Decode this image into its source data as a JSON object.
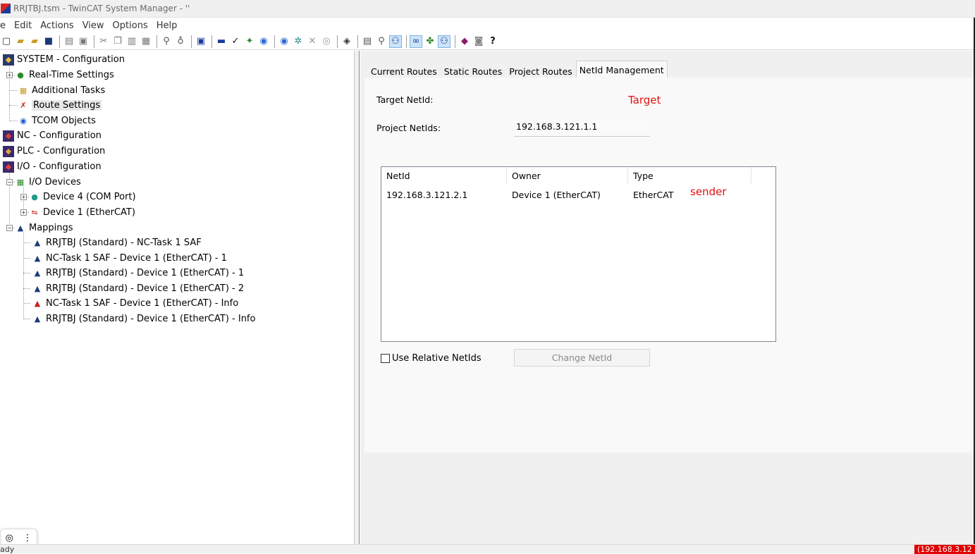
{
  "window": {
    "title": "RRJTBJ.tsm - TwinCAT System Manager - ''"
  },
  "menu": [
    "e",
    "Edit",
    "Actions",
    "View",
    "Options",
    "Help"
  ],
  "tree": {
    "system": "SYSTEM - Configuration",
    "realtime": "Real-Time Settings",
    "tasks": "Additional Tasks",
    "routes": "Route Settings",
    "tcom": "TCOM Objects",
    "nc": "NC - Configuration",
    "plc": "PLC - Configuration",
    "io": "I/O - Configuration",
    "io_devices": "I/O Devices",
    "device4": "Device 4 (COM Port)",
    "device1": "Device 1 (EtherCAT)",
    "mappings": "Mappings",
    "map1": "RRJTBJ (Standard) - NC-Task 1 SAF",
    "map2": "NC-Task 1 SAF - Device 1 (EtherCAT) - 1",
    "map3": "RRJTBJ (Standard) - Device 1 (EtherCAT) - 1",
    "map4": "RRJTBJ (Standard) - Device 1 (EtherCAT) - 2",
    "map5": "NC-Task 1 SAF - Device 1 (EtherCAT) - Info",
    "map6": "RRJTBJ (Standard) - Device 1 (EtherCAT) - Info"
  },
  "tabs": [
    "Current Routes",
    "Static Routes",
    "Project Routes",
    "NetId Management"
  ],
  "netid": {
    "target_label": "Target NetId:",
    "target_value": "192.168.3.121.1.1",
    "target_annotation": "Target",
    "project_label": "Project NetIds:",
    "columns": [
      "NetId",
      "Owner",
      "Type"
    ],
    "rows": [
      {
        "netid": "192.168.3.121.2.1",
        "owner": "Device 1 (EtherCAT)",
        "type": "EtherCAT"
      }
    ],
    "row_annotation": "sender",
    "checkbox_label": "Use Relative NetIds",
    "change_button": "Change NetId"
  },
  "status": {
    "text": "ady",
    "badge": "(192.168.3.12"
  }
}
